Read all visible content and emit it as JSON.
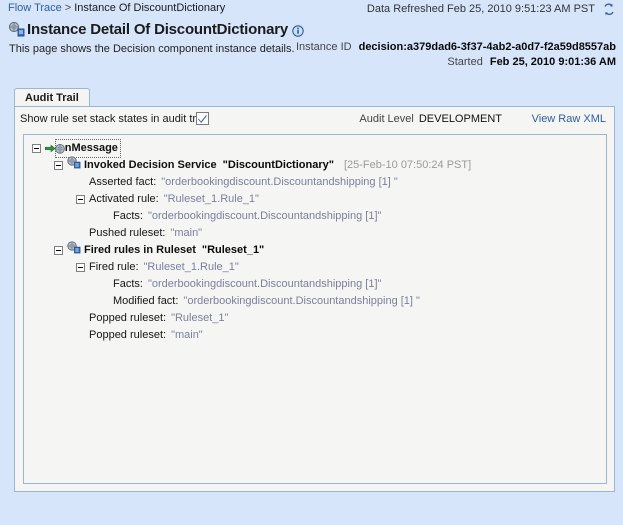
{
  "topbar": {
    "breadcrumb": {
      "root_label": "Flow Trace",
      "separator": ">",
      "current_label": "Instance Of DiscountDictionary"
    },
    "refresh_text": "Data Refreshed Feb 25, 2010 9:51:23 AM PST",
    "refresh_icon": "refresh-icon"
  },
  "header": {
    "title_icon": "decision-component-icon",
    "title": "Instance Detail Of DiscountDictionary",
    "info_icon": "info-icon",
    "subtitle": "This page shows the Decision component instance details.",
    "fields": [
      {
        "label": "Instance ID",
        "value": "decision:a379dad6-3f37-4ab2-a0d7-f2a59d8557ab"
      },
      {
        "label": "Started",
        "value": "Feb 25, 2010 9:01:36 AM"
      }
    ]
  },
  "tabs": [
    {
      "label": "Audit Trail",
      "selected": true
    }
  ],
  "toolbar": {
    "show_stack_label": "Show rule set stack states in audit trail",
    "show_stack_checked": true,
    "audit_level_label": "Audit Level",
    "audit_level_value": "DEVELOPMENT",
    "view_raw_xml_label": "View Raw XML"
  },
  "tree": {
    "rows": [
      {
        "indent": 0,
        "toggle": "expanded",
        "icon": "arrow-gear-icon",
        "label": "onMessage",
        "style": "bold-dotted"
      },
      {
        "indent": 1,
        "toggle": "expanded",
        "icon": "decision-service-icon",
        "label": "Invoked Decision Service",
        "quoted": "\"DiscountDictionary\"",
        "timestamp": "[25-Feb-10 07:50:24 PST]",
        "style": "bold"
      },
      {
        "indent": 2,
        "toggle": "none",
        "label": "Asserted fact:",
        "quoted": "\"orderbookingdiscount.Discountandshipping [1] \"",
        "style": "plain"
      },
      {
        "indent": 2,
        "toggle": "expanded",
        "label": "Activated rule:",
        "quoted": "\"Ruleset_1.Rule_1\"",
        "style": "plain"
      },
      {
        "indent": 3,
        "toggle": "none",
        "label": "Facts:",
        "quoted": "\"orderbookingdiscount.Discountandshipping [1]\"",
        "style": "plain"
      },
      {
        "indent": 2,
        "toggle": "none",
        "label": "Pushed ruleset:",
        "quoted": "\"main\"",
        "style": "plain"
      },
      {
        "indent": 1,
        "toggle": "expanded",
        "icon": "decision-service-icon",
        "label": "Fired rules in Ruleset",
        "quoted": "\"Ruleset_1\"",
        "style": "bold"
      },
      {
        "indent": 2,
        "toggle": "expanded",
        "label": "Fired rule:",
        "quoted": "\"Ruleset_1.Rule_1\"",
        "style": "plain"
      },
      {
        "indent": 3,
        "toggle": "none",
        "label": "Facts:",
        "quoted": "\"orderbookingdiscount.Discountandshipping [1]\"",
        "style": "plain"
      },
      {
        "indent": 3,
        "toggle": "none",
        "label": "Modified fact:",
        "quoted": "\"orderbookingdiscount.Discountandshipping [1] \"",
        "style": "plain"
      },
      {
        "indent": 2,
        "toggle": "none",
        "label": "Popped ruleset:",
        "quoted": "\"Ruleset_1\"",
        "style": "plain"
      },
      {
        "indent": 2,
        "toggle": "none",
        "label": "Popped ruleset:",
        "quoted": "\"main\"",
        "style": "plain"
      }
    ]
  },
  "colors": {
    "page_background": "#d7e5fb",
    "panel_background": "#f5f5f3",
    "border": "#9bb5d6",
    "link": "#2b5fa8",
    "quoted_text": "#7a7f9e",
    "timestamp_text": "#9a9a9a"
  }
}
